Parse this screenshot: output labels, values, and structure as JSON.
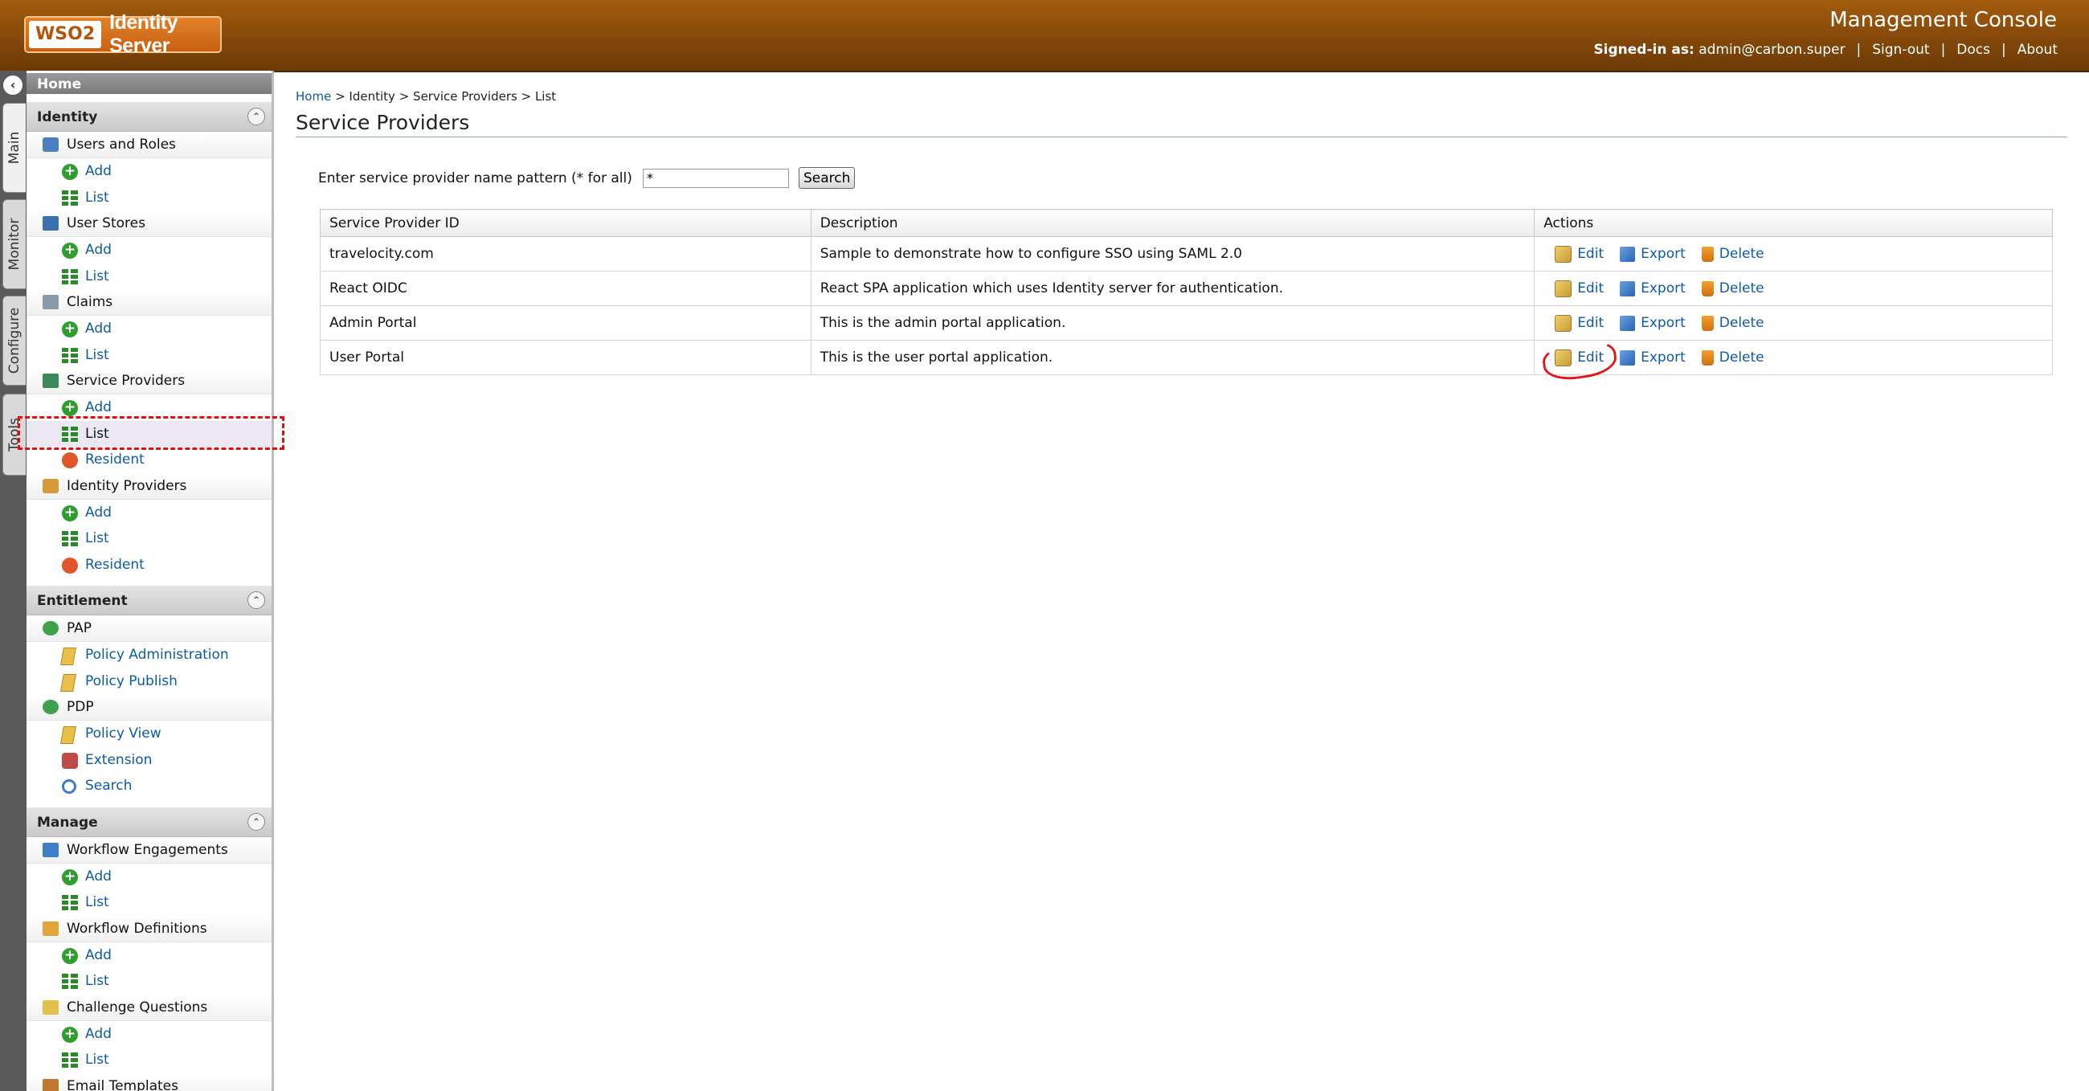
{
  "header": {
    "logo_wso": "WSO2",
    "logo_product": "Identity Server",
    "console_title": "Management Console",
    "signed_in_label": "Signed-in as:",
    "signed_in_user": "admin@carbon.super",
    "links": [
      "Sign-out",
      "Docs",
      "About"
    ]
  },
  "vertical_tabs": [
    "Main",
    "Monitor",
    "Configure",
    "Tools"
  ],
  "sidebar": {
    "home": "Home",
    "sections": [
      {
        "title": "Identity",
        "groups": [
          {
            "label": "Users and Roles",
            "items": [
              "Add",
              "List"
            ]
          },
          {
            "label": "User Stores",
            "items": [
              "Add",
              "List"
            ]
          },
          {
            "label": "Claims",
            "items": [
              "Add",
              "List"
            ]
          },
          {
            "label": "Service Providers",
            "items": [
              "Add",
              "List",
              "Resident"
            ]
          },
          {
            "label": "Identity Providers",
            "items": [
              "Add",
              "List",
              "Resident"
            ]
          }
        ]
      },
      {
        "title": "Entitlement",
        "groups": [
          {
            "label": "PAP",
            "items": [
              "Policy Administration",
              "Policy Publish"
            ]
          },
          {
            "label": "PDP",
            "items": [
              "Policy View",
              "Extension",
              "Search"
            ]
          }
        ]
      },
      {
        "title": "Manage",
        "groups": [
          {
            "label": "Workflow Engagements",
            "items": [
              "Add",
              "List"
            ]
          },
          {
            "label": "Workflow Definitions",
            "items": [
              "Add",
              "List"
            ]
          },
          {
            "label": "Challenge Questions",
            "items": [
              "Add",
              "List"
            ]
          },
          {
            "label": "Email Templates",
            "items": []
          }
        ]
      }
    ]
  },
  "breadcrumb": [
    "Home",
    "Identity",
    "Service Providers",
    "List"
  ],
  "page_title": "Service Providers",
  "search": {
    "label": "Enter service provider name pattern (* for all)",
    "value": "*",
    "button": "Search"
  },
  "table": {
    "headers": [
      "Service Provider ID",
      "Description",
      "Actions"
    ],
    "rows": [
      {
        "id": "travelocity.com",
        "description": "Sample to demonstrate how to configure SSO using SAML 2.0"
      },
      {
        "id": "React OIDC",
        "description": "React SPA application which uses Identity server for authentication."
      },
      {
        "id": "Admin Portal",
        "description": "This is the admin portal application."
      },
      {
        "id": "User Portal",
        "description": "This is the user portal application."
      }
    ],
    "actions": [
      "Edit",
      "Export",
      "Delete"
    ]
  },
  "colors": {
    "header_brown": "#8a4c0a",
    "link_blue": "#0d5aa7",
    "annotation_red": "#e01010"
  }
}
